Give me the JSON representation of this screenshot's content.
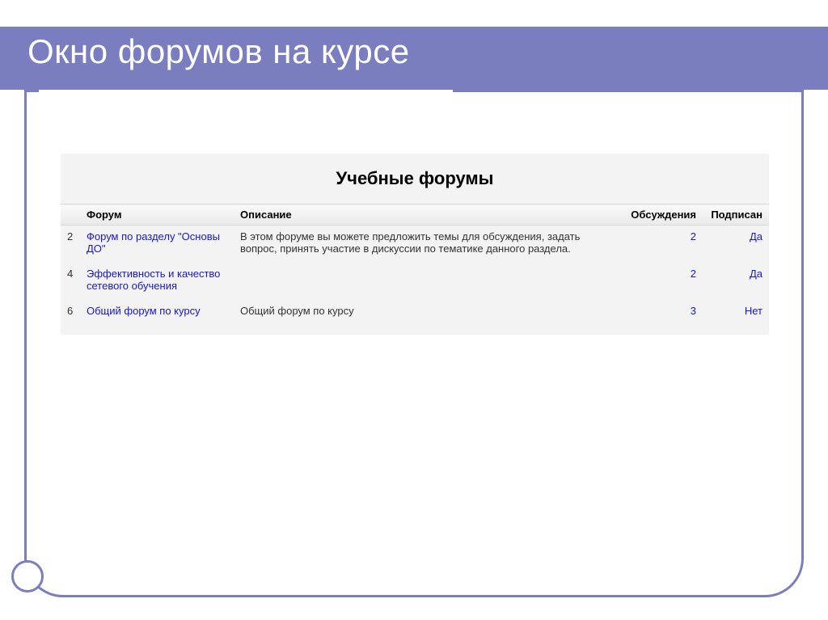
{
  "slide": {
    "title": "Окно форумов на курсе"
  },
  "panel": {
    "title": "Учебные форумы",
    "columns": {
      "num": "",
      "forum": "Форум",
      "desc": "Описание",
      "disc": "Обсуждения",
      "sub": "Подписан"
    },
    "rows": [
      {
        "num": "2",
        "forum": "Форум по разделу \"Основы ДО\"",
        "desc": "В этом форуме вы можете предложить темы для обсуждения, задать вопрос, принять участие в дискуссии по тематике данного раздела.",
        "disc": "2",
        "sub": "Да"
      },
      {
        "num": "4",
        "forum": "Эффективность и качество сетевого обучения",
        "desc": "",
        "disc": "2",
        "sub": "Да"
      },
      {
        "num": "6",
        "forum": "Общий форум по курсу",
        "desc": "Общий форум по курсу",
        "disc": "3",
        "sub": "Нет"
      }
    ]
  }
}
